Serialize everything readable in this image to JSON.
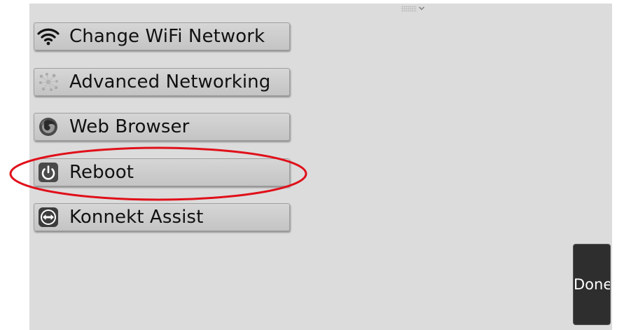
{
  "menu": {
    "items": [
      {
        "label": "Change WiFi Network",
        "icon": "wifi-icon"
      },
      {
        "label": "Advanced Networking",
        "icon": "network-icon"
      },
      {
        "label": "Web Browser",
        "icon": "browser-icon"
      },
      {
        "label": "Reboot",
        "icon": "power-icon"
      },
      {
        "label": "Konnekt Assist",
        "icon": "remote-assist-icon"
      }
    ]
  },
  "done_label": "Done",
  "highlight": {
    "target": "Reboot",
    "color": "#e0101a"
  },
  "colors": {
    "background": "#dcdcdc",
    "button": "#cccccc",
    "done_button": "#2e2e2e"
  }
}
